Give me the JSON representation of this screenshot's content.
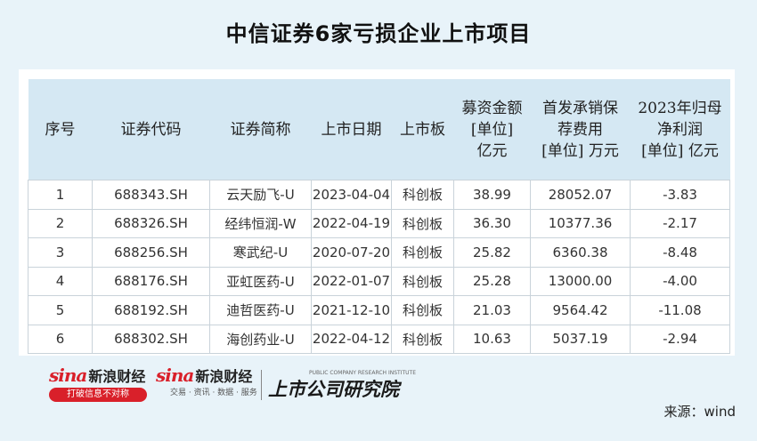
{
  "title": "中信证券6家亏损企业上市项目",
  "table": {
    "headers": [
      [
        "序号"
      ],
      [
        "证券代码"
      ],
      [
        "证券简称"
      ],
      [
        "上市日期"
      ],
      [
        "上市板"
      ],
      [
        "募资金额",
        "[单位]",
        "亿元"
      ],
      [
        "首发承销保",
        "荐费用",
        "[单位] 万元"
      ],
      [
        "2023年归母",
        "净利润",
        "[单位] 亿元"
      ]
    ],
    "rows": [
      [
        "1",
        "688343.SH",
        "云天励飞-U",
        "2023-04-04",
        "科创板",
        "38.99",
        "28052.07",
        "-3.83"
      ],
      [
        "2",
        "688326.SH",
        "经纬恒润-W",
        "2022-04-19",
        "科创板",
        "36.30",
        "10377.36",
        "-2.17"
      ],
      [
        "3",
        "688256.SH",
        "寒武纪-U",
        "2020-07-20",
        "科创板",
        "25.82",
        "6360.38",
        "-8.48"
      ],
      [
        "4",
        "688176.SH",
        "亚虹医药-U",
        "2022-01-07",
        "科创板",
        "25.28",
        "13000.00",
        "-4.00"
      ],
      [
        "5",
        "688192.SH",
        "迪哲医药-U",
        "2021-12-10",
        "科创板",
        "21.03",
        "9564.42",
        "-11.08"
      ],
      [
        "6",
        "688302.SH",
        "海创药业-U",
        "2022-04-12",
        "科创板",
        "10.63",
        "5037.19",
        "-2.94"
      ]
    ]
  },
  "logos": {
    "sina_word": "sina",
    "brand_name": "新浪财经",
    "slogan": "打破信息不对称",
    "brand2_sub": "交易 · 资讯 · 数据 · 服务",
    "research_en": "PUBLIC COMPANY RESEARCH INSTITUTE",
    "research_cn": "上市公司研究院"
  },
  "source": "来源：wind",
  "colors": {
    "background": "#e8f3f9",
    "header_fill": "#d5e8f3",
    "brand_red": "#d9202a",
    "marker_green": "#2e9a2e"
  }
}
